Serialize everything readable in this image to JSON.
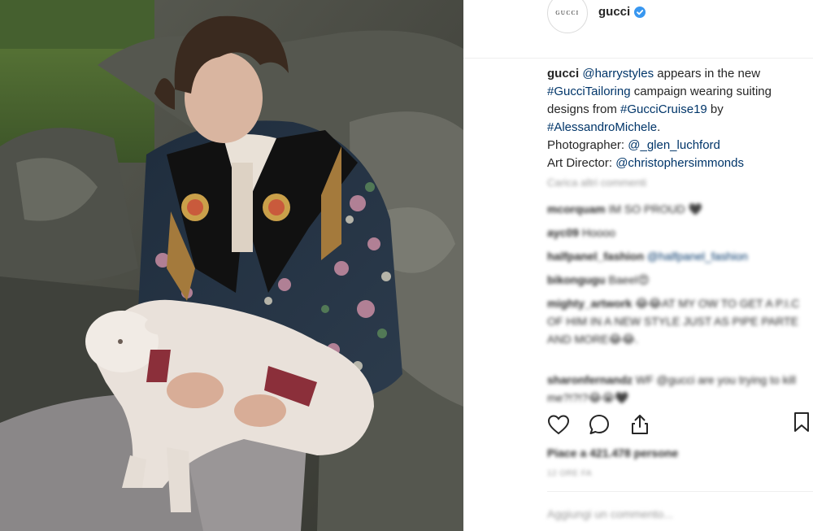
{
  "post": {
    "account": {
      "avatar_text": "GUCCI",
      "username": "gucci",
      "verified": true
    },
    "caption": {
      "username": "gucci",
      "text_parts": [
        {
          "text": "@harrystyles",
          "link": true
        },
        {
          "text": " appears in the new ",
          "link": false
        },
        {
          "text": "#GucciTailoring",
          "link": true
        },
        {
          "text": " campaign wearing suiting designs from ",
          "link": false
        },
        {
          "text": "#GucciCruise19",
          "link": true
        },
        {
          "text": " by ",
          "link": false
        },
        {
          "text": "#AlessandroMichele",
          "link": true
        },
        {
          "text": ".",
          "link": false
        }
      ],
      "photographer_label": "Photographer: ",
      "photographer": "@_glen_luchford",
      "art_director_label": "Art Director: ",
      "art_director": "@christophersimmonds"
    },
    "load_more": "Carica altri commenti",
    "comments": [
      {
        "user": "mcorquam",
        "text": "IM SO PROUD 🖤"
      },
      {
        "user": "ayc09",
        "text": "Hoooo"
      },
      {
        "user": "halfpanel_fashion",
        "text": "@halfpanel_fashion",
        "link": true
      },
      {
        "user": "bikongugu",
        "text": "Baeel😍"
      },
      {
        "user": "mighty_artwork",
        "text": "😂😂AT MY OW TO GET A P.I.C OF HIM IN A NEW STYLE JUST AS PIPE PARTE AND MORE😂😂."
      },
      {
        "user": "sharonfernandz",
        "text": "WF @gucci are you trying to kill me?!?!?😂😭🖤"
      }
    ],
    "actions": {
      "like_icon": "heart-icon",
      "comment_icon": "comment-icon",
      "share_icon": "share-icon",
      "save_icon": "bookmark-icon"
    },
    "likes_text": "Piace a 421.478 persone",
    "date_text": "12 ORE FA",
    "add_comment_placeholder": "Aggiungi un commento..."
  },
  "colors": {
    "link": "#003569",
    "verified": "#3897f0",
    "muted": "#999999"
  }
}
